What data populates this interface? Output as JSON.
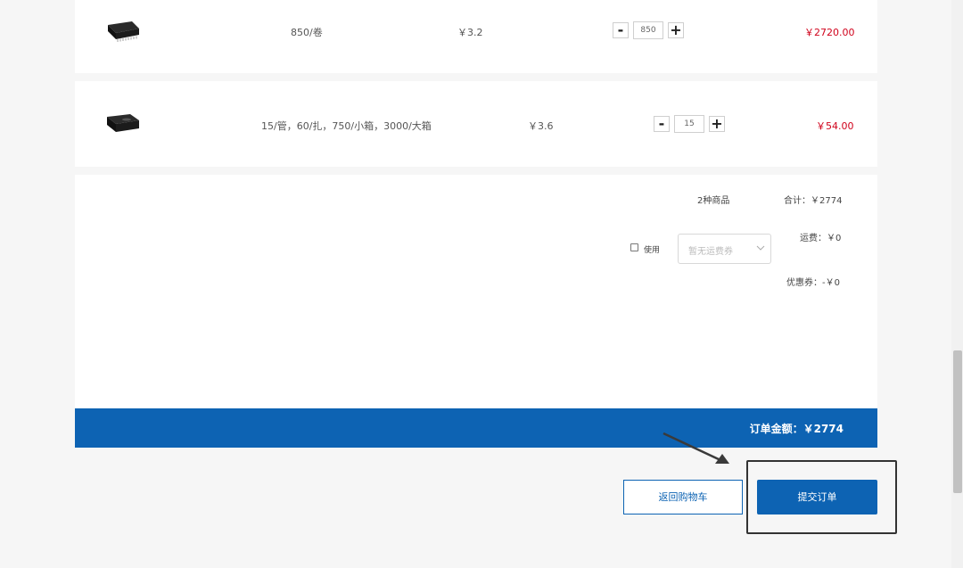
{
  "items": [
    {
      "packaging": "850/卷",
      "unit_price": "￥3.2",
      "quantity": "850",
      "subtotal": "￥2720.00"
    },
    {
      "packaging": "15/管，60/扎，750/小箱，3000/大箱",
      "unit_price": "￥3.6",
      "quantity": "15",
      "subtotal": "￥54.00"
    }
  ],
  "qty_controls": {
    "minus": "-",
    "plus": "+"
  },
  "summary": {
    "item_count": "2种商品",
    "total": "合计：￥2774",
    "use_label": "使用",
    "coupon_placeholder": "暂无运费券",
    "shipping": "运费：￥0",
    "discount": "优惠券：-￥0"
  },
  "order_total": "订单金额：￥2774",
  "buttons": {
    "back_to_cart": "返回购物车",
    "submit_order": "提交订单"
  },
  "colors": {
    "brand_blue": "#0d63b3",
    "price_red": "#d0021b"
  }
}
